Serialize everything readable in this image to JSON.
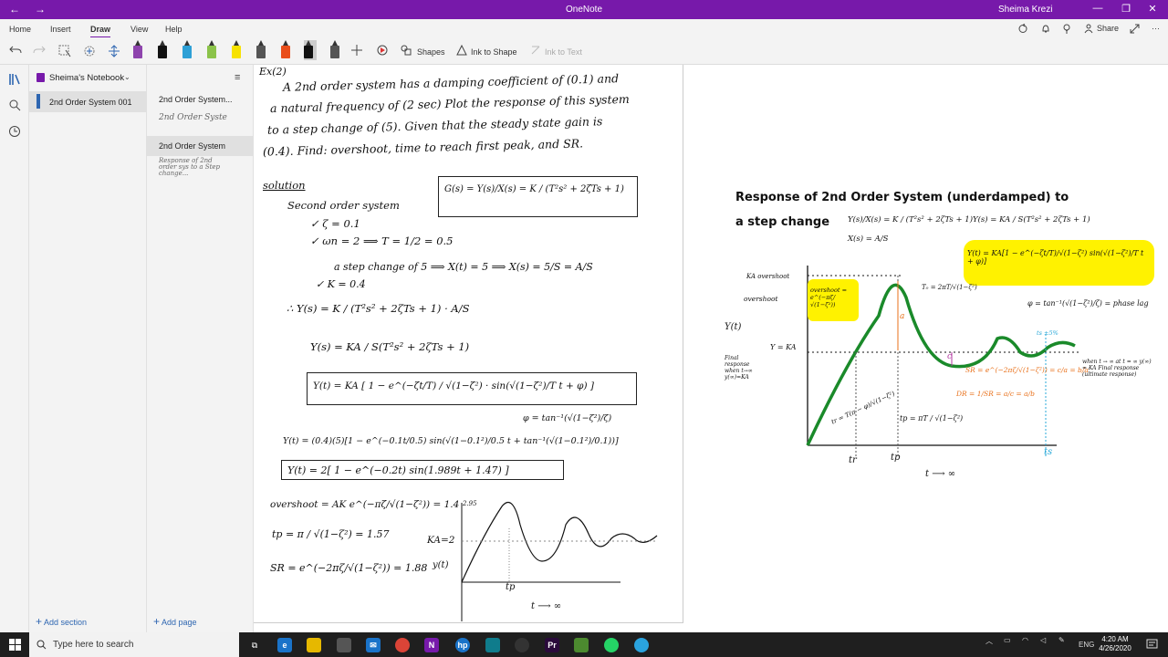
{
  "titlebar": {
    "app_title": "OneNote",
    "user_name": "Sheima Krezi",
    "back_glyph": "←",
    "forward_glyph": "→",
    "minimize_glyph": "—",
    "restore_glyph": "❐",
    "close_glyph": "✕",
    "accent": "#7719aa"
  },
  "ribbon": {
    "tabs": [
      "Home",
      "Insert",
      "Draw",
      "View",
      "Help"
    ],
    "active_tab": "Draw",
    "share_label": "Share"
  },
  "toolbar": {
    "shapes_label": "Shapes",
    "ink_to_shape_label": "Ink to Shape",
    "ink_to_text_label": "Ink to Text",
    "pen_colors": [
      "#8e44ad",
      "#111111",
      "#2ea0d6",
      "#8bc34a",
      "#f7e200",
      "#555555",
      "#e94e1b",
      "#111111",
      "#555555"
    ]
  },
  "notebook": {
    "name": "Sheima's Notebook",
    "section": "2nd Order System 001",
    "section_color": "#2e66b1",
    "add_section_label": "Add section",
    "add_page_label": "Add page"
  },
  "pages": [
    {
      "title": "2nd Order System...",
      "preview": "2nd Order Syste"
    },
    {
      "title": "2nd Order System",
      "preview": "Response of 2nd order sys to a Step change..."
    }
  ],
  "left_notes": {
    "example_tag": "Ex(2)",
    "line1": "A 2nd order system has a damping coefficient of (0.1) and",
    "line2": "a natural frequency of (2 sec) Plot the response of this system",
    "line3": "to a step change of (5). Given that the steady state gain is",
    "line4": "(0.4). Find: overshoot, time to reach first peak, and SR.",
    "solution": "solution",
    "second_order": "Second order system",
    "transfer": "G(s) = Y(s)/X(s) = K / (T²s² + 2ζTs + 1)",
    "zeta": "✓ ζ = 0.1",
    "wn": "✓ ωn = 2 ⟹ T = 1/2 = 0.5",
    "step": "a step change of 5 ⟹ X(t) = 5 ⟹ X(s) = 5/S = A/S",
    "k": "✓ K = 0.4",
    "ys1": "∴ Y(s) = K / (T²s² + 2ζTs + 1) · A/S",
    "ys2": "Y(s) = KA / S(T²s² + 2ζTs + 1)",
    "yt": "Y(t) = KA [ 1 − e^(−ζt/T) / √(1−ζ²) · sin(√(1−ζ²)/T t + φ) ]",
    "phi": "φ = tan⁻¹(√(1−ζ²)/ζ)",
    "yt_sub": "Y(t) = (0.4)(5)[1 − e^(−0.1t/0.5) sin(√(1−0.1²)/0.5 t + tan⁻¹(√(1−0.1²)/0.1))]",
    "yt_final": "Y(t) = 2[ 1 − e^(−0.2t) sin(1.989t + 1.47) ]",
    "overshoot": "overshoot = AK e^(−πζ/√(1−ζ²)) = 1.4",
    "tp": "tp = π / √(1−ζ²) = 1.57",
    "sr": "SR = e^(−2πζ/√(1−ζ²)) = 1.88",
    "plot_peak": "2.95",
    "plot_ka": "KA=2",
    "plot_y": "y(t)",
    "plot_tp": "tp",
    "plot_t": "t ⟶ ∞"
  },
  "right_notes": {
    "title": "Response of 2nd Order System (underdamped) to",
    "title2": "a step change",
    "eq1": "Y(s)/X(s) = K / (T²s² + 2ζTs + 1)",
    "eq_xs": "X(s) = A/S",
    "eq2": "Y(s) = KA / S(T²s² + 2ζTs + 1)",
    "yt": "Y(t) = KA[1 − e^(−ζt/T)/√(1−ζ²) sin(√(1−ζ²)/T t + φ)]",
    "phi": "φ = tan⁻¹(√(1−ζ²)/ζ) = phase lag",
    "ka_overshoot": "KA overshoot",
    "overshoot": "overshoot",
    "overshoot_formula": "overshoot = e^(−πζ/√(1−ζ²))",
    "y_label": "Y(t)",
    "y_ka": "Y = KA",
    "final_resp": "Final response when t→∞ y(∞)=KA",
    "period": "T₀ = 2πT/√(1−ζ²)",
    "a_label": "a",
    "c_label": "c",
    "tr_label": "tr",
    "tp_label": "tp",
    "ts_label": "ts",
    "t_axis": "t ⟶ ∞",
    "tp_formula": "tp = πT / √(1−ζ²)",
    "tr_formula": "tr = T(π − φ)/√(1−ζ²)",
    "sr_formula": "SR = e^(−2πζ/√(1−ζ²)) = c/a = b/a",
    "dr_formula": "DR = 1/SR = a/c = a/b",
    "ts_note": "ts ±5%",
    "right_note": "when t → ∞ at t = ∞ y(∞) = KA Final response (ultimate response)",
    "green": "#1a8a2a",
    "highlight": "#fff200",
    "orange": "#e8701a",
    "purple": "#b23aa0",
    "cyan": "#29a8d8"
  },
  "taskbar": {
    "search_placeholder": "Type here to search",
    "lang": "ENG",
    "time": "4:20 AM",
    "date": "4/26/2020"
  }
}
